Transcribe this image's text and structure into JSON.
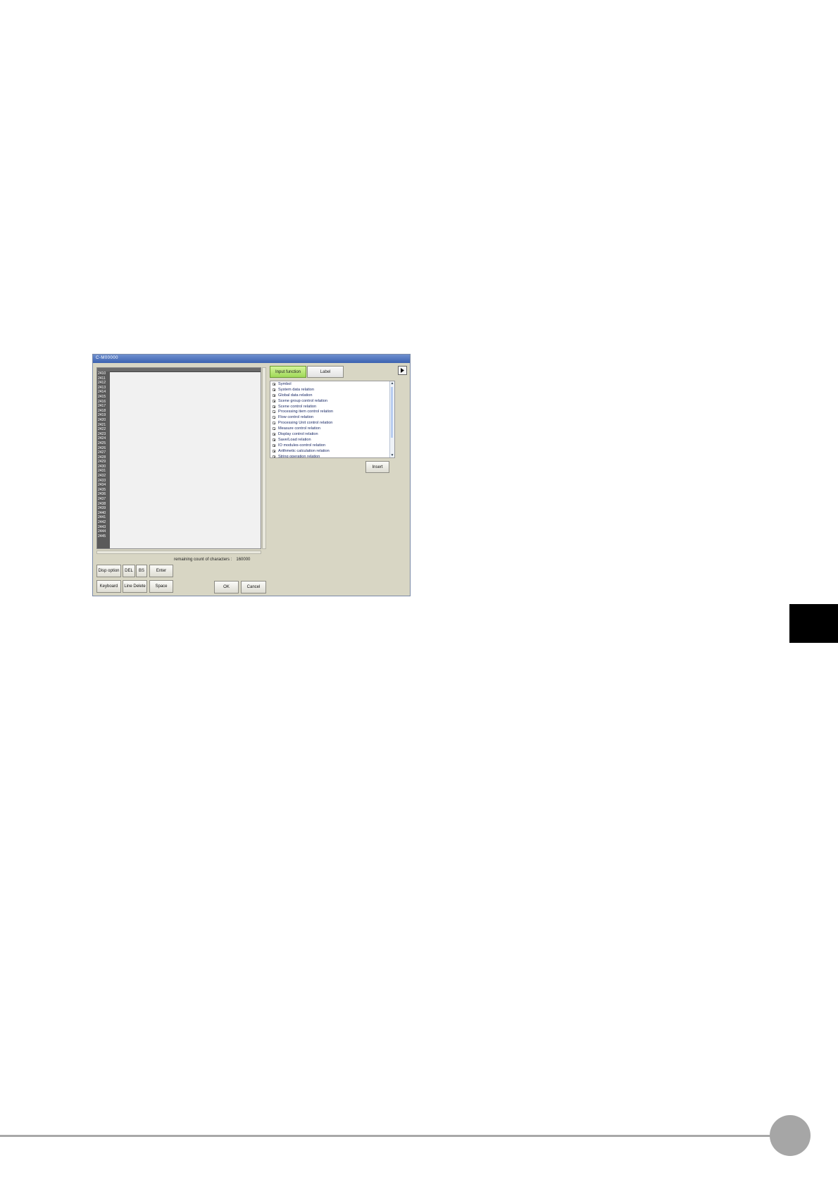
{
  "window": {
    "title": "C-M00000"
  },
  "editor": {
    "line_numbers": [
      "2410",
      "2411",
      "2412",
      "2413",
      "2414",
      "2415",
      "2416",
      "2417",
      "2418",
      "2419",
      "2420",
      "2421",
      "2422",
      "2423",
      "2424",
      "2425",
      "2426",
      "2427",
      "2428",
      "2429",
      "2430",
      "2431",
      "2432",
      "2433",
      "2434",
      "2435",
      "2436",
      "2437",
      "2438",
      "2439",
      "2440",
      "2441",
      "2442",
      "2443",
      "2444",
      "2445"
    ],
    "remaining_label": "remaining count of characters :",
    "remaining_value": "160000"
  },
  "buttons": {
    "disp_option": "Disp option",
    "del": "DEL",
    "bs": "BS",
    "enter": "Enter",
    "keyboard": "Keyboard",
    "line_delete": "Line Delete",
    "space": "Space",
    "ok": "OK",
    "cancel": "Cancel",
    "insert": "Insert"
  },
  "tabs": {
    "input_function": "Input function",
    "label": "Label"
  },
  "tree": {
    "items": [
      "Symbol",
      "System data relation",
      "Global data relation",
      "Scene group control relation",
      "Scene control relation",
      "Processing item control relation",
      "Flow control relation",
      "Processing Unit control relation",
      "Measure control relation",
      "Display control relation",
      "Save/Load relation",
      "IO modules-control relation",
      "Arithmetic calculation relation",
      "String operation relation"
    ]
  },
  "icons": {
    "expand": "plus-box-icon",
    "panel_toggle": "arrow-right-icon"
  },
  "colors": {
    "titlebar": "#3c62b0",
    "active_tab": "#9fd858",
    "window_bg": "#d8d6c4"
  }
}
